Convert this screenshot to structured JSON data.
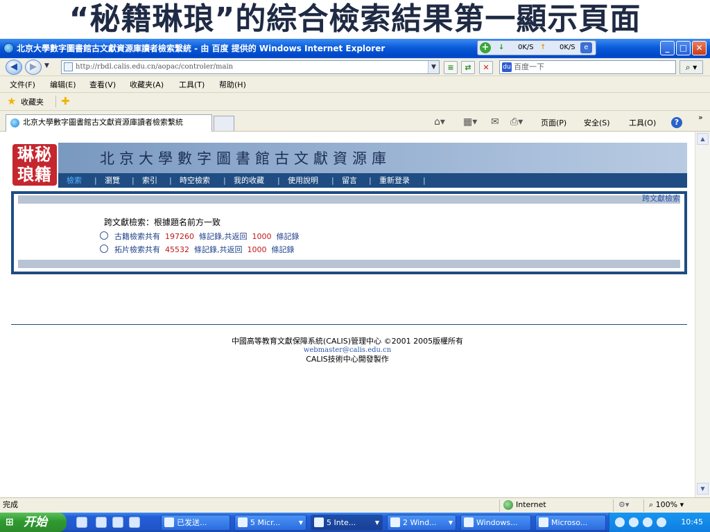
{
  "slide": {
    "title": "“秘籍琳琅”的綜合檢索結果第一顯示頁面"
  },
  "window": {
    "title": "北京大學數字圖書館古文獻資源庫讀者檢索繫統 - 由 百度 提供的 Windows Internet Explorer",
    "speed_down": "0K/S",
    "speed_up": "0K/S"
  },
  "address": {
    "url": "http://rbdl.calis.edu.cn/aopac/controler/main",
    "search_placeholder": "百度一下"
  },
  "menu": [
    "文件(F)",
    "编辑(E)",
    "查看(V)",
    "收藏夹(A)",
    "工具(T)",
    "帮助(H)"
  ],
  "favorites": {
    "label": "收藏夹"
  },
  "tab": {
    "label": "北京大學數字圖書館古文獻資源庫讀者檢索繫統"
  },
  "commands": {
    "page": "页面(P)",
    "safety": "安全(S)",
    "tools": "工具(O)",
    "more": "»"
  },
  "site": {
    "seal": "琳秘琅籍",
    "banner": "北京大學數字圖書館古文獻資源庫",
    "nav": [
      "檢索",
      "瀏覽",
      "索引",
      "時空檢索",
      "我的收藏",
      "使用說明",
      "留言",
      "重新登录"
    ],
    "cross_link": "跨文獻檢索",
    "heading": "跨文獻檢索：根據題名前方一致",
    "results": [
      {
        "prefix": "古籍檢索共有",
        "total": "197260",
        "mid": "條記錄,共返回",
        "returned": "1000",
        "suffix": "條記錄"
      },
      {
        "prefix": "拓片檢索共有",
        "total": "45532",
        "mid": "條記錄,共返回",
        "returned": "1000",
        "suffix": "條記錄"
      }
    ],
    "footer": {
      "line1": "中國高等教育文獻保障系統(CALIS)管理中心  ©2001 2005版權所有",
      "email": "webmaster@calis.edu.cn",
      "line3": "CALIS技術中心開發製作"
    }
  },
  "status": {
    "text": "完成",
    "zone": "Internet",
    "zoom": "100%"
  },
  "taskbar": {
    "start": "开始",
    "tasks": [
      "已发送...",
      "5 Micr...",
      "5 Inte...",
      "2 Wind...",
      "Windows...",
      "Microso..."
    ],
    "clock": "10:45"
  },
  "colors": {
    "accent": "#1f4c82",
    "link": "#2a55a8",
    "number": "#c0161a"
  }
}
